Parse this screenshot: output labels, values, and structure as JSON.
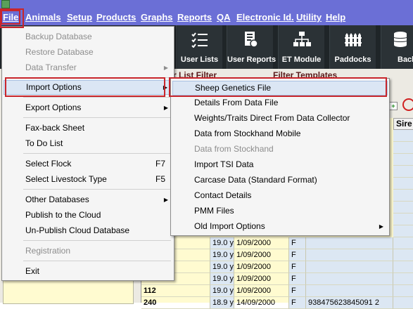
{
  "menubar": {
    "items": [
      "File",
      "Animals",
      "Setup",
      "Products",
      "Graphs",
      "Reports",
      "QA",
      "Electronic Id.",
      "Utility",
      "Help"
    ]
  },
  "toolbar": {
    "buttons": [
      {
        "label": "User Lists",
        "icon": "checklist-icon"
      },
      {
        "label": "User Reports",
        "icon": "report-icon"
      },
      {
        "label": "ET Module",
        "icon": "network-icon"
      },
      {
        "label": "Paddocks",
        "icon": "fence-icon"
      },
      {
        "label": "Back",
        "icon": "database-icon"
      }
    ]
  },
  "filters": {
    "user_list_filter": "r List Filter",
    "filter_templates": "Filter Templates"
  },
  "file_menu": {
    "items": [
      {
        "label": "Backup Database",
        "disabled": true
      },
      {
        "label": "Restore Database",
        "disabled": true
      },
      {
        "label": "Data Transfer",
        "disabled": true,
        "submenu": true
      },
      {
        "label": "Import Options",
        "submenu": true,
        "highlighted": true
      },
      {
        "label": "Export Options",
        "submenu": true
      },
      {
        "label": "Fax-back Sheet"
      },
      {
        "label": "To Do List"
      },
      {
        "label": "Select Flock",
        "shortcut": "F7"
      },
      {
        "label": "Select Livestock Type",
        "shortcut": "F5"
      },
      {
        "label": "Other Databases",
        "submenu": true
      },
      {
        "label": "Publish to the Cloud"
      },
      {
        "label": "Un-Publish Cloud Database"
      },
      {
        "label": "Registration",
        "disabled": true
      },
      {
        "label": "Exit"
      }
    ]
  },
  "import_menu": {
    "items": [
      {
        "label": "Sheep Genetics File",
        "highlighted": true
      },
      {
        "label": "Details From Data File"
      },
      {
        "label": "Weights/Traits Direct From Data Collector"
      },
      {
        "label": "Data from Stockhand Mobile"
      },
      {
        "label": "Data from Stockhand",
        "disabled": true
      },
      {
        "label": "Import TSI Data"
      },
      {
        "label": "Carcase Data (Standard Format)"
      },
      {
        "label": "Contact Details"
      },
      {
        "label": "PMM Files"
      },
      {
        "label": "Old Import Options",
        "submenu": true
      }
    ]
  },
  "grid": {
    "sire_header": "Sire",
    "rows": [
      {
        "id": "",
        "age": "19.0 y",
        "date": "1/09/2000",
        "sex": "F",
        "tag": ""
      },
      {
        "id": "",
        "age": "19.0 y",
        "date": "1/09/2000",
        "sex": "F",
        "tag": ""
      },
      {
        "id": "",
        "age": "19.0 y",
        "date": "1/09/2000",
        "sex": "F",
        "tag": ""
      },
      {
        "id": "",
        "age": "19.0 y",
        "date": "1/09/2000",
        "sex": "F",
        "tag": ""
      },
      {
        "id": "112",
        "age": "19.0 y",
        "date": "1/09/2000",
        "sex": "F",
        "tag": ""
      },
      {
        "id": "240",
        "age": "18.9 y",
        "date": "14/09/2000",
        "sex": "F",
        "tag": "938475623845091 2"
      }
    ]
  },
  "colors": {
    "menubar_bg": "#6b6fd6",
    "toolbar_bg": "#1f2528",
    "highlight": "#dbe6f4",
    "callout_red": "#c8252b"
  }
}
